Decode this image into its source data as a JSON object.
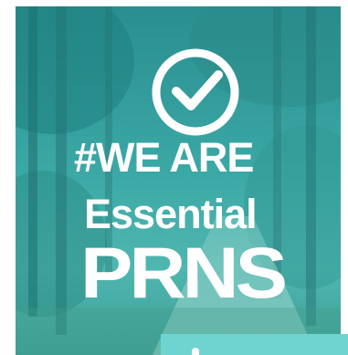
{
  "poster": {
    "line1": "#WE ARE",
    "line2": "Essential",
    "line3": "PRNS"
  },
  "icons": {
    "badge": "checkmark-circle-icon"
  },
  "colors": {
    "overlay": "#3aa7a5",
    "text": "#ffffff",
    "card": "#6fd3cf"
  }
}
